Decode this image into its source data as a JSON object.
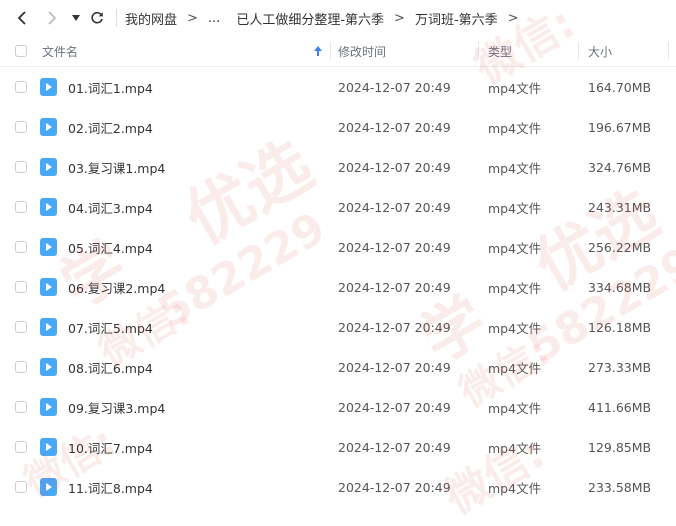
{
  "nav": {
    "crumbs": [
      "我的网盘",
      "...",
      "已人工做细分整理-第六季",
      "万词班-第六季"
    ]
  },
  "columns": {
    "name": "文件名",
    "modified": "修改时间",
    "type": "类型",
    "size": "大小"
  },
  "files": [
    {
      "name": "01.词汇1.mp4",
      "modified": "2024-12-07 20:49",
      "type": "mp4文件",
      "size": "164.70MB"
    },
    {
      "name": "02.词汇2.mp4",
      "modified": "2024-12-07 20:49",
      "type": "mp4文件",
      "size": "196.67MB"
    },
    {
      "name": "03.复习课1.mp4",
      "modified": "2024-12-07 20:49",
      "type": "mp4文件",
      "size": "324.76MB"
    },
    {
      "name": "04.词汇3.mp4",
      "modified": "2024-12-07 20:49",
      "type": "mp4文件",
      "size": "243.31MB"
    },
    {
      "name": "05.词汇4.mp4",
      "modified": "2024-12-07 20:49",
      "type": "mp4文件",
      "size": "256.22MB"
    },
    {
      "name": "06.复习课2.mp4",
      "modified": "2024-12-07 20:49",
      "type": "mp4文件",
      "size": "334.68MB"
    },
    {
      "name": "07.词汇5.mp4",
      "modified": "2024-12-07 20:49",
      "type": "mp4文件",
      "size": "126.18MB"
    },
    {
      "name": "08.词汇6.mp4",
      "modified": "2024-12-07 20:49",
      "type": "mp4文件",
      "size": "273.33MB"
    },
    {
      "name": "09.复习课3.mp4",
      "modified": "2024-12-07 20:49",
      "type": "mp4文件",
      "size": "411.66MB"
    },
    {
      "name": "10.词汇7.mp4",
      "modified": "2024-12-07 20:49",
      "type": "mp4文件",
      "size": "129.85MB"
    },
    {
      "name": "11.词汇8.mp4",
      "modified": "2024-12-07 20:49",
      "type": "mp4文件",
      "size": "233.58MB"
    }
  ],
  "colors": {
    "icon_blue": "#4aa8f8",
    "sort_arrow": "#3b82f6",
    "watermark": "#d64646"
  },
  "watermark": {
    "lines": [
      "学",
      "微信:",
      "优选",
      "582229"
    ]
  }
}
